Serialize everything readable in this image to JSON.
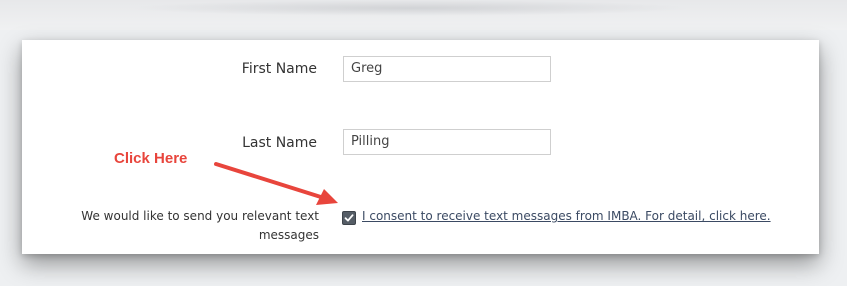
{
  "form": {
    "first_name": {
      "label": "First Name",
      "value": "Greg"
    },
    "last_name": {
      "label": "Last Name",
      "value": "Pilling"
    },
    "consent": {
      "prompt": "We would like to send you relevant text messages",
      "checked": true,
      "link_text": "I consent to receive text messages from IMBA. For detail, click here."
    }
  },
  "annotation": {
    "note": "Click Here",
    "color": "#e8453c"
  },
  "icons": {
    "check": "checkbox-check-icon",
    "arrow": "annotation-arrow-icon"
  }
}
